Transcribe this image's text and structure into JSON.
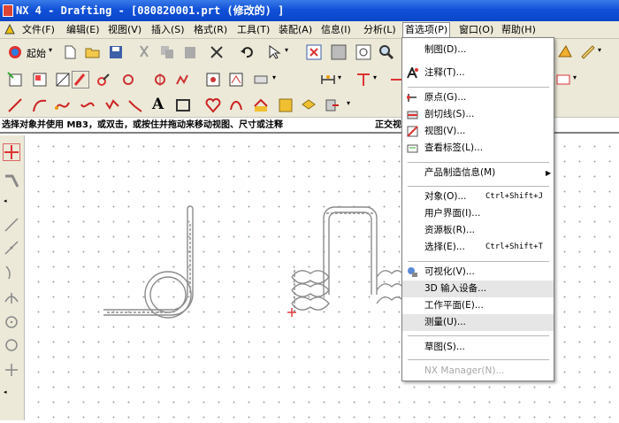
{
  "window": {
    "title": "NX 4 - Drafting - [080820001.prt  (修改的) ]"
  },
  "menubar": {
    "items": [
      {
        "label": "文件(F)"
      },
      {
        "label": "编辑(E)"
      },
      {
        "label": "视图(V)"
      },
      {
        "label": "插入(S)"
      },
      {
        "label": "格式(R)"
      },
      {
        "label": "工具(T)"
      },
      {
        "label": "装配(A)"
      },
      {
        "label": "信息(I)"
      },
      {
        "label": "分析(L)"
      },
      {
        "label": "首选项(P)"
      },
      {
        "label": "窗口(O)"
      },
      {
        "label": "帮助(H)"
      }
    ]
  },
  "toolbar": {
    "start_label": "起始",
    "start_icon": "nx-start-icon"
  },
  "status": {
    "prompt": "选择对象并使用 MB3，或双击，或按住并拖动来移动视图、尺寸或注释",
    "right": "正交视"
  },
  "dropdown": {
    "items": [
      {
        "label": "制图(D)...",
        "icon": "",
        "shortcut": ""
      },
      {
        "label": "注释(T)...",
        "icon": "annotation-icon",
        "shortcut": ""
      },
      {
        "label": "原点(G)...",
        "icon": "origin-icon",
        "shortcut": ""
      },
      {
        "label": "剖切线(S)...",
        "icon": "section-line-icon",
        "shortcut": ""
      },
      {
        "label": "视图(V)...",
        "icon": "view-icon",
        "shortcut": ""
      },
      {
        "label": "查看标签(L)...",
        "icon": "view-label-icon",
        "shortcut": ""
      },
      {
        "label": "产品制造信息(M)",
        "icon": "",
        "shortcut": ""
      },
      {
        "label": "对象(O)...",
        "icon": "",
        "shortcut": "Ctrl+Shift+J"
      },
      {
        "label": "用户界面(I)...",
        "icon": "",
        "shortcut": ""
      },
      {
        "label": "资源板(R)...",
        "icon": "",
        "shortcut": ""
      },
      {
        "label": "选择(E)...",
        "icon": "",
        "shortcut": "Ctrl+Shift+T"
      },
      {
        "label": "可视化(V)...",
        "icon": "visualization-icon",
        "shortcut": ""
      },
      {
        "label": "3D 输入设备...",
        "icon": "",
        "shortcut": ""
      },
      {
        "label": "工作平面(E)...",
        "icon": "",
        "shortcut": ""
      },
      {
        "label": "测量(U)...",
        "icon": "",
        "shortcut": ""
      },
      {
        "label": "草图(S)...",
        "icon": "",
        "shortcut": ""
      },
      {
        "label": "NX Manager(N)...",
        "icon": "",
        "shortcut": ""
      }
    ]
  },
  "colors": {
    "titlebar": "#0a46c8",
    "menu_bg": "#ece9d8",
    "canvas_line": "#9a9a9a"
  }
}
